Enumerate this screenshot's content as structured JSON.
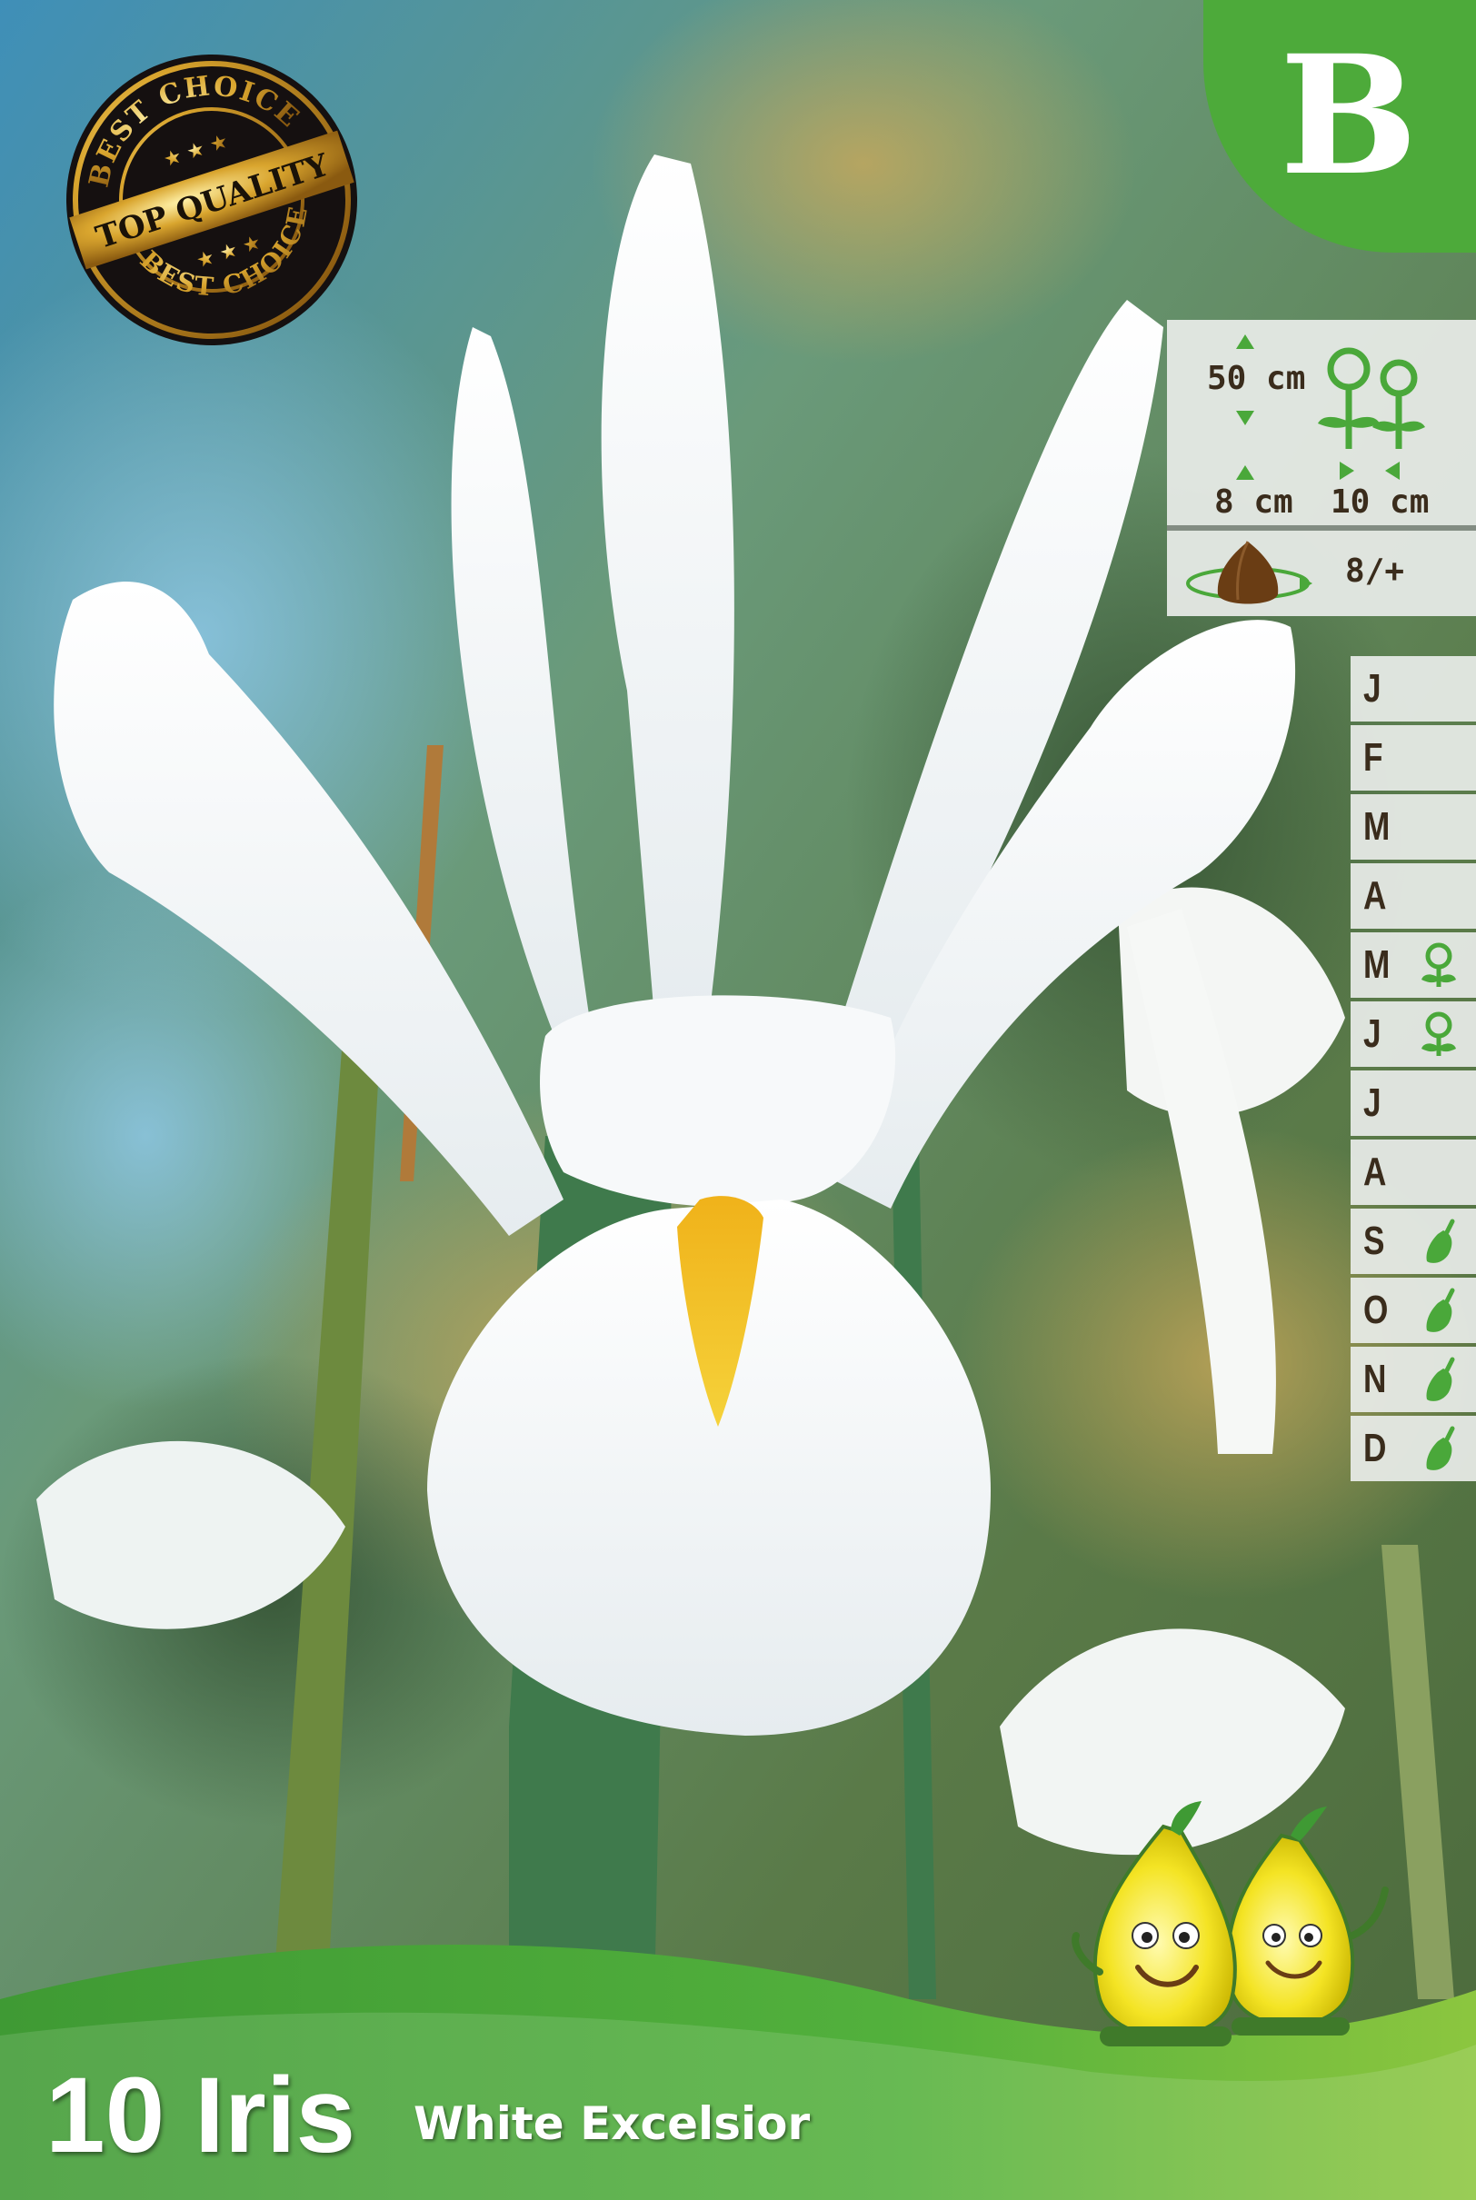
{
  "grade": {
    "letter": "B",
    "color": "#4daa3a"
  },
  "seal": {
    "top_text": "BEST CHOICE",
    "middle_text": "TOP QUALITY",
    "bottom_text": "BEST CHOICE"
  },
  "info": {
    "height": "50 cm",
    "planting_depth": "8 cm",
    "spacing": "10 cm",
    "bulb_size": "8/+",
    "icons": [
      "arrow-up-icon",
      "arrow-down-icon",
      "plants-icon",
      "bulb-icon",
      "rotate-icon"
    ]
  },
  "calendar": {
    "months": [
      {
        "label": "J",
        "icon": ""
      },
      {
        "label": "F",
        "icon": ""
      },
      {
        "label": "M",
        "icon": ""
      },
      {
        "label": "A",
        "icon": ""
      },
      {
        "label": "M",
        "icon": "flower-icon"
      },
      {
        "label": "J",
        "icon": "flower-icon"
      },
      {
        "label": "J",
        "icon": ""
      },
      {
        "label": "A",
        "icon": ""
      },
      {
        "label": "S",
        "icon": "trowel-icon"
      },
      {
        "label": "O",
        "icon": "trowel-icon"
      },
      {
        "label": "N",
        "icon": "trowel-icon"
      },
      {
        "label": "D",
        "icon": "trowel-icon"
      }
    ]
  },
  "product": {
    "count_name": "10 Iris",
    "cultivar": "White Excelsior"
  },
  "colors": {
    "brand_green": "#4daa3a",
    "text_brown": "#3a2c1c"
  }
}
